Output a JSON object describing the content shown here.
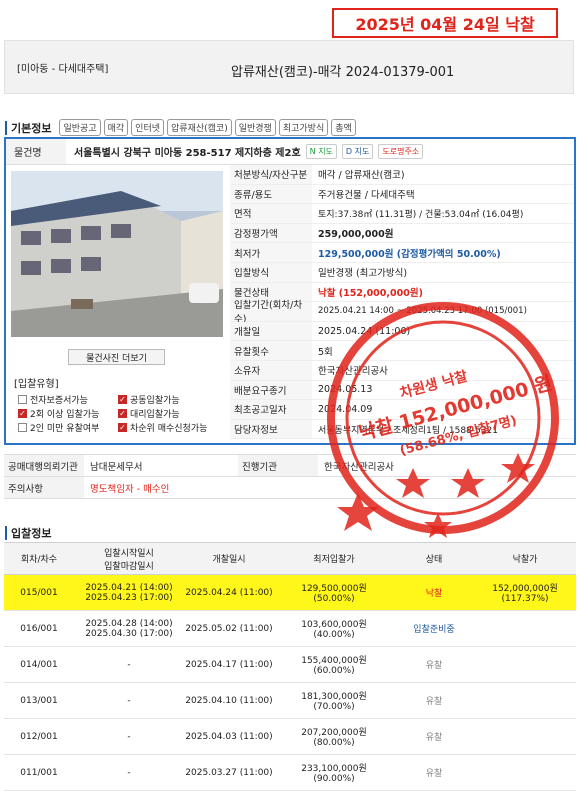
{
  "stamp_top": "2025년 04월 24일 낙찰",
  "title": {
    "category": "[미아동 - 다세대주택]",
    "case": "압류재산(캠코)-매각 2024-01379-001"
  },
  "basic": {
    "heading": "기본정보",
    "chips": [
      "일반공고",
      "매각",
      "인터넷",
      "압류재산(캠코)",
      "일반경쟁",
      "최고가방식",
      "총액"
    ]
  },
  "property": {
    "name_label": "물건명",
    "address": "서울특별시 강북구 미아동 258-517 제지하층 제2호",
    "map_buttons": [
      "N 지도",
      "D 지도",
      "도로명주소"
    ],
    "photo_button": "물건사진 더보기",
    "bid_type_heading": "[입찰유형]",
    "bid_options": [
      {
        "label": "전자보증서가능",
        "checked": false
      },
      {
        "label": "공동입찰가능",
        "checked": true
      },
      {
        "label": "2회 이상 입찰가능",
        "checked": true
      },
      {
        "label": "대리입찰가능",
        "checked": true
      },
      {
        "label": "2인 미만 유찰여부",
        "checked": false
      },
      {
        "label": "차순위 매수신청가능",
        "checked": true
      }
    ]
  },
  "details": [
    {
      "label": "처분방식/자산구분",
      "value": "매각 / 압류재산(캠코)"
    },
    {
      "label": "종류/용도",
      "value": "주거용건물 / 다세대주택"
    },
    {
      "label": "면적",
      "value": "토지:37.38㎡ (11.31평) / 건물:53.04㎡ (16.04평)"
    },
    {
      "label": "감정평가액",
      "value": "259,000,000원"
    },
    {
      "label": "최저가",
      "value": "129,500,000원 (감정평가액의 50.00%)"
    },
    {
      "label": "입찰방식",
      "value": "일반경쟁 (최고가방식)"
    },
    {
      "label": "물건상태",
      "value": "낙찰 (152,000,000원)"
    },
    {
      "label": "입찰기간(회차/차수)",
      "value": "2025.04.21 14:00 ~ 2025.04.23 17:00 (015/001)"
    },
    {
      "label": "개찰일",
      "value": "2025.04.24 (11:00)"
    },
    {
      "label": "유찰횟수",
      "value": "5회"
    },
    {
      "label": "소유자",
      "value": "한국자산관리공사"
    },
    {
      "label": "배분요구종기",
      "value": "2024.05.13"
    },
    {
      "label": "최초공고일자",
      "value": "2024.04.09"
    },
    {
      "label": "담당자정보",
      "value": "서울동부지역본부 / 조세정리1팀 / 1588-5321"
    }
  ],
  "meta": [
    {
      "label": "공매대행의뢰기관",
      "value": "남대문세무서",
      "label2": "진행기관",
      "value2": "한국자산관리공사"
    },
    {
      "label": "주의사항",
      "value": "명도책임자 - 매수인"
    }
  ],
  "bid_info": {
    "heading": "입찰정보",
    "headers": [
      "회차/차수",
      "입찰시작일시\n입찰마감일시",
      "개찰일시",
      "최저입찰가",
      "상태",
      "낙찰가"
    ],
    "rows": [
      {
        "round": "015/001",
        "start": "2025.04.21 (14:00)",
        "end": "2025.04.23 (17:00)",
        "open": "2025.04.24 (11:00)",
        "min": "129,500,000원",
        "min_pct": "(50.00%)",
        "status": "낙찰",
        "win": "152,000,000원",
        "win_pct": "(117.37%)"
      },
      {
        "round": "016/001",
        "start": "2025.04.28 (14:00)",
        "end": "2025.04.30 (17:00)",
        "open": "2025.05.02 (11:00)",
        "min": "103,600,000원",
        "min_pct": "(40.00%)",
        "status": "입찰준비중",
        "win": "",
        "win_pct": ""
      },
      {
        "round": "014/001",
        "start": "-",
        "end": "",
        "open": "2025.04.17 (11:00)",
        "min": "155,400,000원",
        "min_pct": "(60.00%)",
        "status": "유찰",
        "win": "",
        "win_pct": ""
      },
      {
        "round": "013/001",
        "start": "-",
        "end": "",
        "open": "2025.04.10 (11:00)",
        "min": "181,300,000원",
        "min_pct": "(70.00%)",
        "status": "유찰",
        "win": "",
        "win_pct": ""
      },
      {
        "round": "012/001",
        "start": "-",
        "end": "",
        "open": "2025.04.03 (11:00)",
        "min": "207,200,000원",
        "min_pct": "(80.00%)",
        "status": "유찰",
        "win": "",
        "win_pct": ""
      },
      {
        "round": "011/001",
        "start": "-",
        "end": "",
        "open": "2025.03.27 (11:00)",
        "min": "233,100,000원",
        "min_pct": "(90.00%)",
        "status": "유찰",
        "win": "",
        "win_pct": ""
      }
    ]
  },
  "seal": {
    "line1": "낙찰 152,000,000 원",
    "line2": "(58.68%, 입찰7명)",
    "line3": "차원생 낙찰"
  },
  "colors": {
    "accent": "#2c74c8",
    "stamp": "#e0241b",
    "highlight": "#fff61a"
  }
}
